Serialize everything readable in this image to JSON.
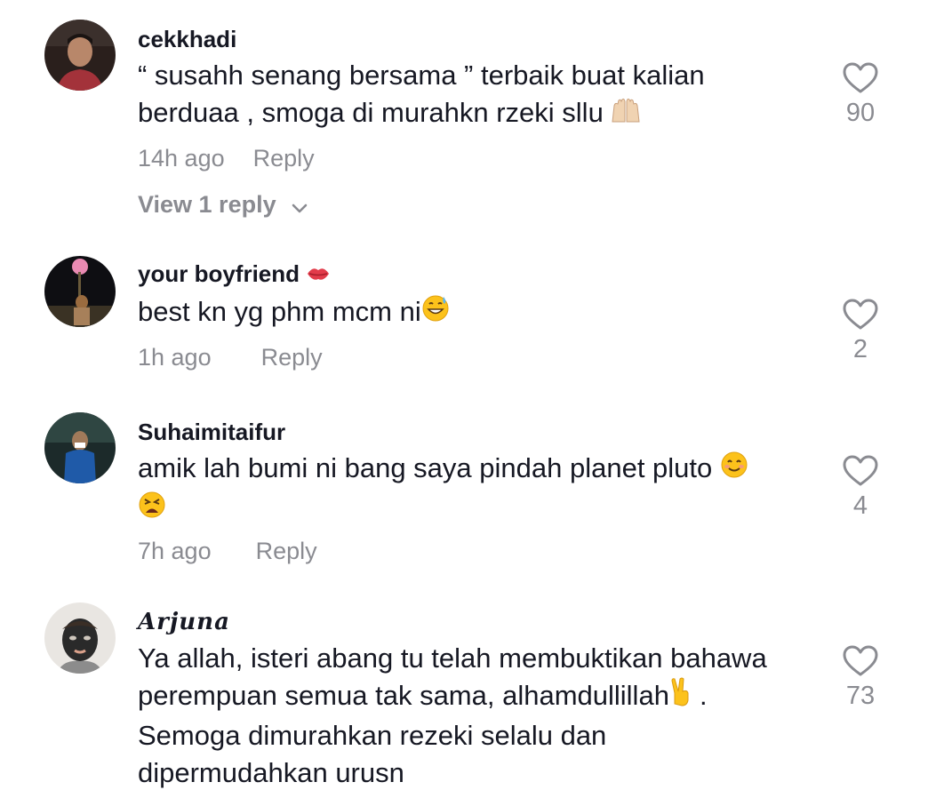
{
  "comments": [
    {
      "username": "cekkhadi",
      "lines": [
        "“ susahh senang bersama ” terbaik buat kalian",
        "berduaa , smoga di murahkn rzeki sllu"
      ],
      "line_emoji": "raised-hands",
      "time": "14h ago",
      "reply_label": "Reply",
      "likes": "90",
      "view_replies": "View 1 reply"
    },
    {
      "username": "your boyfriend",
      "username_emoji": "kiss-mark",
      "lines": [
        "best kn yg phm mcm ni"
      ],
      "line_emoji": "grinning-sweat",
      "time": "1h ago",
      "reply_label": "Reply",
      "likes": "2"
    },
    {
      "username": "Suhaimitaifur",
      "lines": [
        "amik lah bumi ni bang saya pindah planet pluto"
      ],
      "line_emoji": "smiling-face",
      "second_line_emoji": "weary-face",
      "time": "7h ago",
      "reply_label": "Reply",
      "likes": "4"
    },
    {
      "username": "Arjuna",
      "lines": [
        "Ya allah, isteri abang tu telah membuktikan bahawa",
        "perempuan semua tak sama, alhamdullillah",
        "Semoga dimurahkan rezeki selalu dan",
        "dipermudahkan urusn"
      ],
      "line_suffix": ".",
      "line_emoji": "victory-hand",
      "likes": "73"
    }
  ],
  "colors": {
    "text": "#161823",
    "muted": "#8a8b91"
  }
}
